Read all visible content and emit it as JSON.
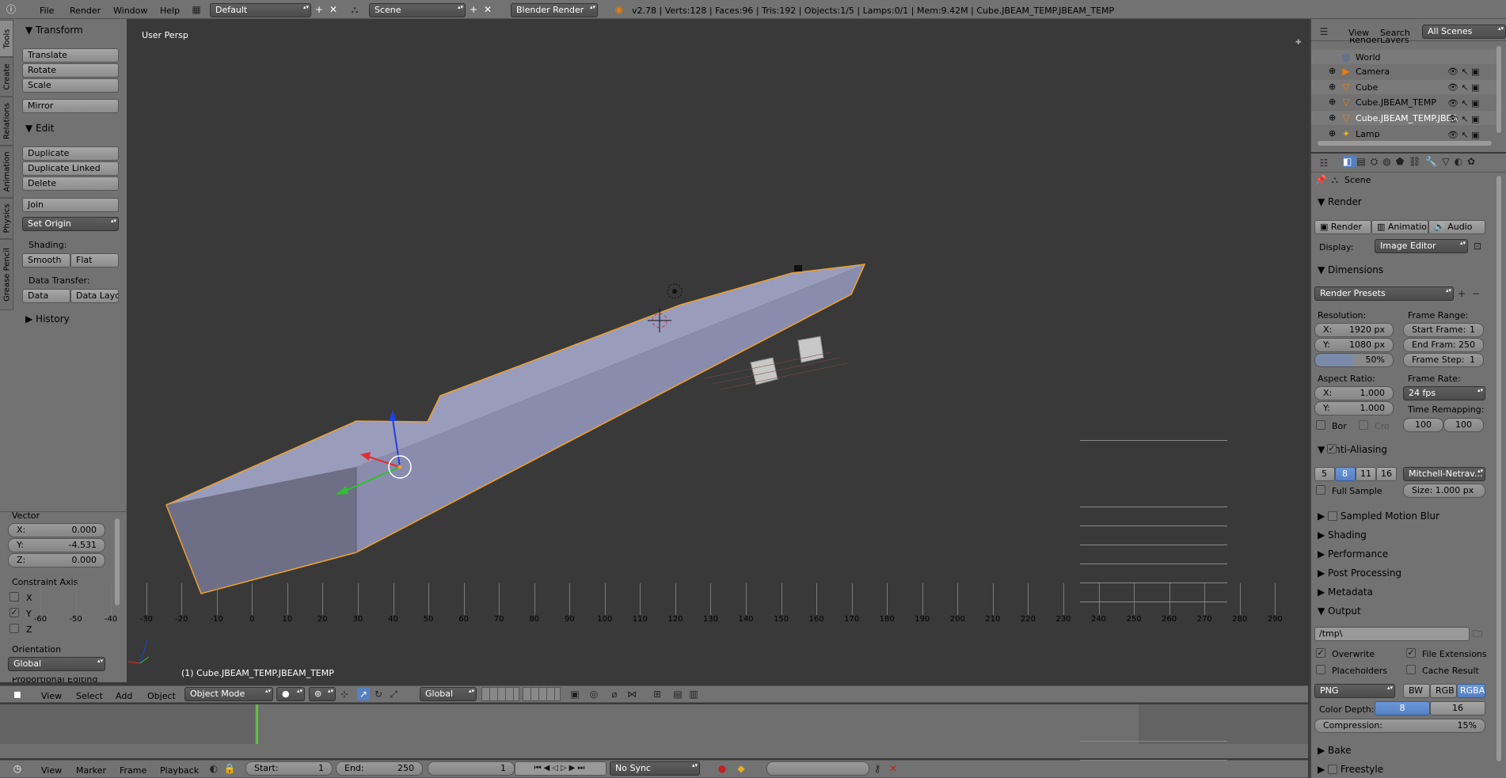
{
  "top_header": {
    "menus": [
      "File",
      "Render",
      "Window",
      "Help"
    ],
    "layout": "Default",
    "scene": "Scene",
    "engine": "Blender Render",
    "stats": "v2.78 | Verts:128 | Faces:96 | Tris:192 | Objects:1/5 | Lamps:0/1 | Mem:9.42M | Cube.JBEAM_TEMP.JBEAM_TEMP"
  },
  "tool_tabs": [
    "Tools",
    "Create",
    "Relations",
    "Animation",
    "Physics",
    "Grease Pencil"
  ],
  "tools": {
    "transform_title": "Transform",
    "translate": "Translate",
    "rotate": "Rotate",
    "scale": "Scale",
    "mirror": "Mirror",
    "edit_title": "Edit",
    "duplicate": "Duplicate",
    "duplicate_linked": "Duplicate Linked",
    "delete": "Delete",
    "join": "Join",
    "set_origin": "Set Origin",
    "shading_label": "Shading:",
    "smooth": "Smooth",
    "flat": "Flat",
    "data_transfer_label": "Data Transfer:",
    "data": "Data",
    "data_layout": "Data Layo",
    "history_title": "History"
  },
  "operator": {
    "vector_label": "Vector",
    "x_label": "X:",
    "x_value": "0.000",
    "y_label": "Y:",
    "y_value": "-4.531",
    "z_label": "Z:",
    "z_value": "0.000",
    "constraint_label": "Constraint Axis",
    "cx": "X",
    "cy": "Y",
    "cz": "Z",
    "orientation_label": "Orientation",
    "orientation": "Global",
    "cut_text": "Proportional Editing"
  },
  "viewport": {
    "view_name": "User Persp",
    "object_label": "(1) Cube.JBEAM_TEMP.JBEAM_TEMP"
  },
  "view_header": {
    "menus": [
      "View",
      "Select",
      "Add",
      "Object"
    ],
    "mode": "Object Mode",
    "orientation": "Global"
  },
  "timeline": {
    "ticks": [
      "-60",
      "-50",
      "-40",
      "-30",
      "-20",
      "-10",
      "0",
      "10",
      "20",
      "30",
      "40",
      "50",
      "60",
      "70",
      "80",
      "90",
      "100",
      "110",
      "120",
      "130",
      "140",
      "150",
      "160",
      "170",
      "180",
      "190",
      "200",
      "210",
      "220",
      "230",
      "240",
      "250",
      "260",
      "270",
      "280",
      "290"
    ],
    "current_frame": 0
  },
  "timeline_header": {
    "menus": [
      "View",
      "Marker",
      "Frame",
      "Playback"
    ],
    "start_label": "Start:",
    "start": "1",
    "end_label": "End:",
    "end": "250",
    "current": "1",
    "sync": "No Sync"
  },
  "outliner": {
    "menus": [
      "View",
      "Search"
    ],
    "filter": "All Scenes",
    "cut_item": "RenderLayers",
    "items": [
      "World",
      "Camera",
      "Cube",
      "Cube.JBEAM_TEMP",
      "Cube.JBEAM_TEMP.JBEA",
      "Lamp"
    ]
  },
  "properties": {
    "context": "Scene",
    "render_title": "Render",
    "render_btn": "Render",
    "animation_btn": "Animation",
    "audio_btn": "Audio",
    "display_label": "Display:",
    "display": "Image Editor",
    "dimensions_title": "Dimensions",
    "presets": "Render Presets",
    "resolution_label": "Resolution:",
    "res_x_label": "X:",
    "res_x": "1920 px",
    "res_y_label": "Y:",
    "res_y": "1080 px",
    "res_pct": "50%",
    "frame_range_label": "Frame Range:",
    "start_frame_label": "Start Frame:",
    "start_frame": "1",
    "end_frame_label": "End Fram:",
    "end_frame": "250",
    "frame_step_label": "Frame Step:",
    "frame_step": "1",
    "aspect_label": "Aspect Ratio:",
    "asp_x_label": "X:",
    "asp_x": "1.000",
    "asp_y_label": "Y:",
    "asp_y": "1.000",
    "border_label": "Bor",
    "crop_label": "Cro",
    "frame_rate_label": "Frame Rate:",
    "frame_rate": "24 fps",
    "time_remap_label": "Time Remapping:",
    "remap_old": "100",
    "remap_new": "100",
    "aa_title": "Anti-Aliasing",
    "aa_samples": [
      "5",
      "8",
      "11",
      "16"
    ],
    "aa_filter": "Mitchell-Netrav...",
    "full_sample": "Full Sample",
    "size_label": "Size:",
    "size": "1.000 px",
    "motion_blur_title": "Sampled Motion Blur",
    "shading_title": "Shading",
    "performance_title": "Performance",
    "post_title": "Post Processing",
    "metadata_title": "Metadata",
    "output_title": "Output",
    "output_path": "/tmp\\",
    "overwrite": "Overwrite",
    "file_ext": "File Extensions",
    "placeholders": "Placeholders",
    "cache_result": "Cache Result",
    "format": "PNG",
    "bw": "BW",
    "rgb": "RGB",
    "rgba": "RGBA",
    "color_depth_label": "Color Depth:",
    "depth8": "8",
    "depth16": "16",
    "compression_label": "Compression:",
    "compression": "15%",
    "bake_title": "Bake",
    "freestyle_title": "Freestyle"
  },
  "colors": {
    "accent_blue": "#5680c2",
    "selection_orange": "#f0a030",
    "viewport_bg": "#393939"
  }
}
